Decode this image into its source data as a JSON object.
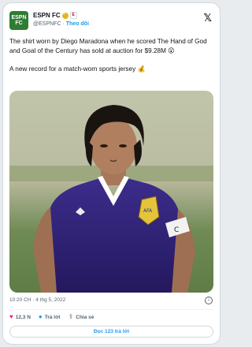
{
  "account": {
    "display_name": "ESPN FC",
    "handle": "@ESPNFC",
    "follow_label": "Theo dõi",
    "avatar_text": [
      "ESPN",
      "FC"
    ],
    "brand_color": "#2e7d32"
  },
  "tweet": {
    "text": "The shirt worn by Diego Maradona when he scored The Hand of God and Goal of the Century has sold at auction for $9.28M 😮\n\nA new record for a match-worn sports jersey 💰",
    "time": "10:20 CH · 4 thg 5, 2022"
  },
  "actions": {
    "likes": "12,3 N",
    "reply_label": "Trả lời",
    "share_label": "Chia sẻ",
    "read_replies_label": "Đọc 123 trả lời"
  },
  "icons": {
    "platform": "x-logo-icon",
    "like": "heart-icon",
    "reply": "reply-icon",
    "share": "share-icon",
    "info": "info-icon"
  }
}
